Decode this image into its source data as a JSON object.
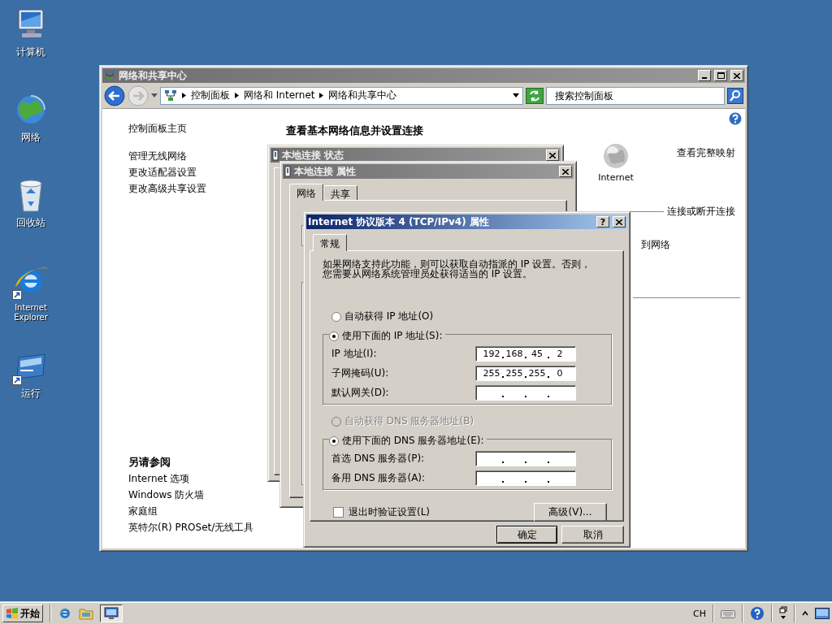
{
  "desktop_icons": [
    {
      "label": "计算机",
      "kind": "computer",
      "shortcut": false
    },
    {
      "label": "网络",
      "kind": "network",
      "shortcut": false
    },
    {
      "label": "回收站",
      "kind": "recycle",
      "shortcut": false
    },
    {
      "label": "Internet Explorer",
      "kind": "browser",
      "shortcut": true
    },
    {
      "label": "运行",
      "kind": "run",
      "shortcut": true
    }
  ],
  "main_window": {
    "title": "网络和共享中心",
    "breadcrumb": [
      "控制面板",
      "网络和 Internet",
      "网络和共享中心"
    ],
    "search": {
      "placeholder": "搜索控制面板"
    },
    "sidebar": {
      "home": "控制面板主页",
      "links": [
        "管理无线网络",
        "更改适配器设置",
        "更改高级共享设置"
      ],
      "see_also_title": "另请参阅",
      "see_also": [
        "Internet 选项",
        "Windows 防火墙",
        "家庭组",
        "英特尔(R) PROSet/无线工具"
      ]
    },
    "heading": "查看基本网络信息并设置连接",
    "internet_label": "Internet",
    "full_map": "查看完整映射",
    "connect_link": "连接或断开连接",
    "partial_text": "到网络"
  },
  "status_dialog": {
    "title": "本地连接 状态"
  },
  "properties_dialog": {
    "title": "本地连接 属性",
    "tabs": [
      {
        "label": "网络",
        "selected": true
      },
      {
        "label": "共享",
        "selected": false
      }
    ]
  },
  "ipv4_dialog": {
    "title": "Internet 协议版本 4 (TCP/IPv4) 属性",
    "help_button": "?",
    "tabs": [
      {
        "label": "常规",
        "selected": true
      }
    ],
    "description": [
      "如果网络支持此功能，则可以获取自动指派的 IP 设置。否则，",
      "您需要从网络系统管理员处获得适当的 IP 设置。"
    ],
    "ip_radios": [
      {
        "label": "自动获得 IP 地址(O)",
        "selected": false,
        "disabled": false
      },
      {
        "label": "使用下面的 IP 地址(S):",
        "selected": true,
        "disabled": false
      }
    ],
    "ip_fields": [
      {
        "label": "IP 地址(I):",
        "octets": [
          "192",
          "168",
          "45",
          "2"
        ]
      },
      {
        "label": "子网掩码(U):",
        "octets": [
          "255",
          "255",
          "255",
          "0"
        ]
      },
      {
        "label": "默认网关(D):"
      }
    ],
    "dns_radios": [
      {
        "label": "自动获得 DNS 服务器地址(B)",
        "selected": false,
        "disabled": true
      },
      {
        "label": "使用下面的 DNS 服务器地址(E):",
        "selected": true,
        "disabled": false
      }
    ],
    "dns_fields": [
      {
        "label": "首选 DNS 服务器(P):"
      },
      {
        "label": "备用 DNS 服务器(A):"
      }
    ],
    "validate": {
      "label": "退出时验证设置(L)",
      "checked": false
    },
    "advanced": "高级(V)...",
    "ok": "确定",
    "cancel": "取消"
  },
  "taskbar": {
    "start": "开始",
    "language": "CH"
  }
}
